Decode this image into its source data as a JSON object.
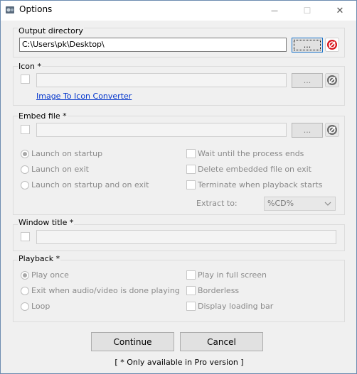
{
  "window": {
    "title": "Options",
    "minimize_glyph": "—",
    "maximize_glyph": "☐",
    "close_glyph": "✕"
  },
  "output": {
    "group_label": "Output directory",
    "path_value": "C:\\Users\\pk\\Desktop\\",
    "browse_label": "...",
    "clear_icon": "clear-icon"
  },
  "icon": {
    "group_label": "Icon *",
    "path_value": "",
    "browse_label": "...",
    "converter_link": "Image To Icon Converter"
  },
  "embed": {
    "group_label": "Embed file *",
    "path_value": "",
    "browse_label": "...",
    "launch_options": [
      "Launch on startup",
      "Launch on exit",
      "Launch on startup and on exit"
    ],
    "selected_launch": "Launch on startup",
    "check_options": [
      "Wait until the process ends",
      "Delete embedded file on exit",
      "Terminate when playback starts"
    ],
    "extract_label": "Extract to:",
    "extract_value": "%CD%"
  },
  "window_title": {
    "group_label": "Window title *",
    "value": ""
  },
  "playback": {
    "group_label": "Playback *",
    "radio_options": [
      "Play once",
      "Exit when audio/video is done playing",
      "Loop"
    ],
    "selected": "Play once",
    "check_options": [
      "Play in full screen",
      "Borderless",
      "Display loading bar"
    ]
  },
  "buttons": {
    "continue": "Continue",
    "cancel": "Cancel"
  },
  "footnote": "[ * Only available in Pro version ]",
  "colors": {
    "accent_border": "#1c74c9",
    "clear_red": "#d9141b",
    "link": "#0033cc"
  }
}
